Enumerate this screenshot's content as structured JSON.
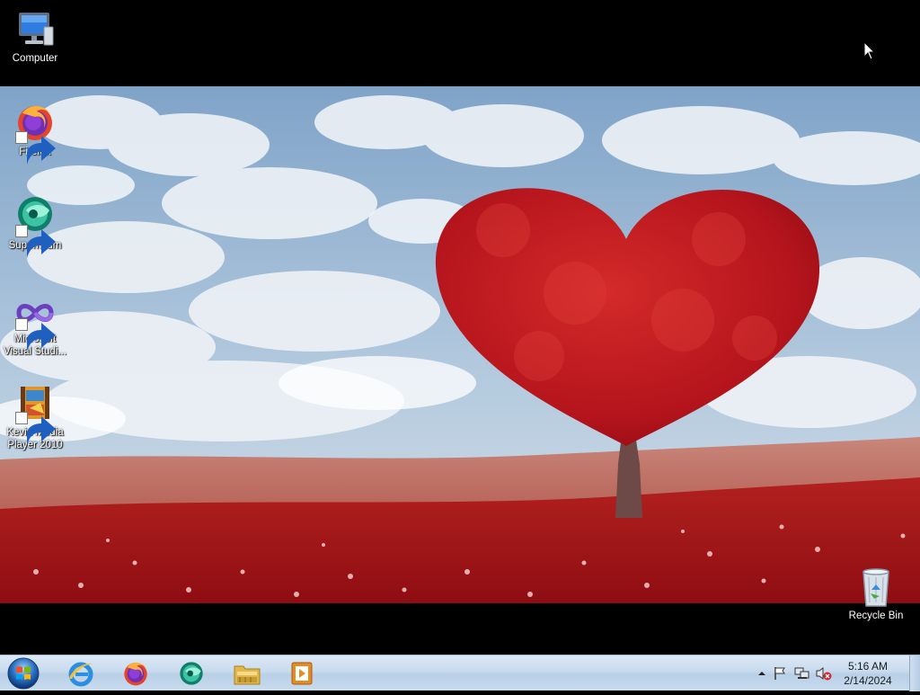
{
  "desktop": {
    "icons": [
      {
        "label": "Computer",
        "icon": "computer-icon",
        "shortcut": false
      },
      {
        "label": "Firefox",
        "icon": "firefox-icon",
        "shortcut": true
      },
      {
        "label": "Supermium",
        "icon": "supermium-icon",
        "shortcut": true
      },
      {
        "label": "Microsoft Visual Studi...",
        "icon": "visual-studio-icon",
        "shortcut": true
      },
      {
        "label": "Kevin Media Player 2010",
        "icon": "media-player-icon",
        "shortcut": true
      },
      {
        "label": "Recycle Bin",
        "icon": "recycle-bin-icon",
        "shortcut": false
      }
    ],
    "wallpaper": "heart-tree-wallpaper"
  },
  "taskbar": {
    "start": "windows-start-orb",
    "pinned": [
      {
        "name": "Internet Explorer",
        "icon": "internet-explorer-icon"
      },
      {
        "name": "Firefox",
        "icon": "firefox-icon"
      },
      {
        "name": "Supermium",
        "icon": "supermium-icon"
      },
      {
        "name": "Windows Explorer",
        "icon": "folder-icon"
      },
      {
        "name": "Media Player",
        "icon": "media-player-icon"
      }
    ],
    "tray": {
      "icons": [
        "show-hidden-icons-arrow",
        "action-center-flag-icon",
        "network-icon",
        "volume-muted-icon"
      ],
      "time": "5:16 AM",
      "date": "2/14/2024"
    }
  },
  "colors": {
    "taskbar": "#c8dbee",
    "desktop_bg": "#000000"
  }
}
